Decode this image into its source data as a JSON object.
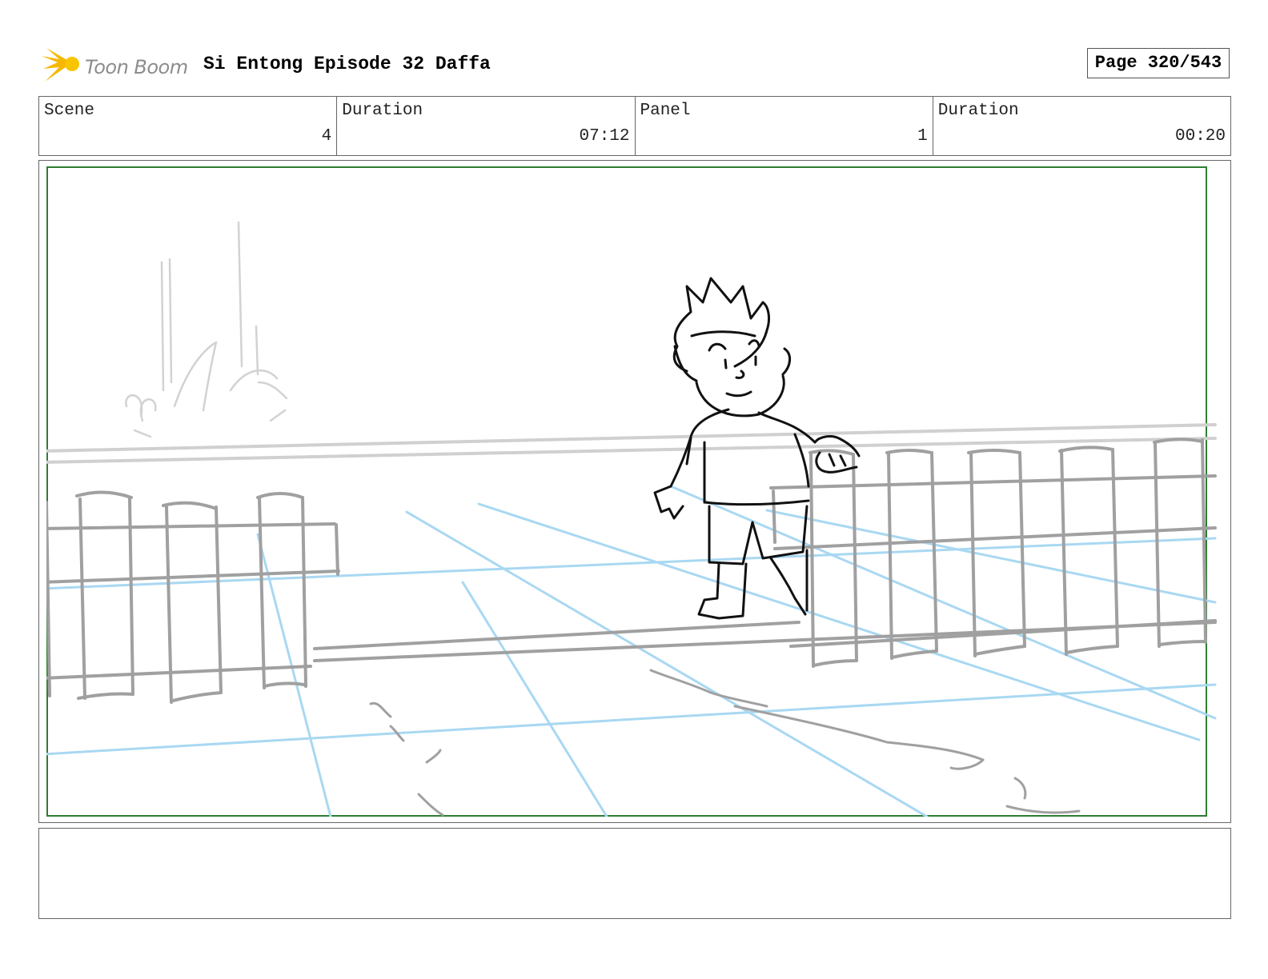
{
  "header": {
    "logo_text": "Toon Boom",
    "title": "Si Entong Episode 32 Daffa",
    "page": "Page 320/543"
  },
  "info": {
    "scene_label": "Scene",
    "scene_value": "4",
    "scene_duration_label": "Duration",
    "scene_duration_value": "07:12",
    "panel_label": "Panel",
    "panel_value": "1",
    "panel_duration_label": "Duration",
    "panel_duration_value": "00:20"
  },
  "colors": {
    "frame_border": "#2e7d32",
    "perspective_guides": "#a9d8f2",
    "background_sketch": "#a0a0a0",
    "character_lines": "#111111",
    "logo_star": "#f6b800"
  },
  "notes": {
    "text": ""
  }
}
